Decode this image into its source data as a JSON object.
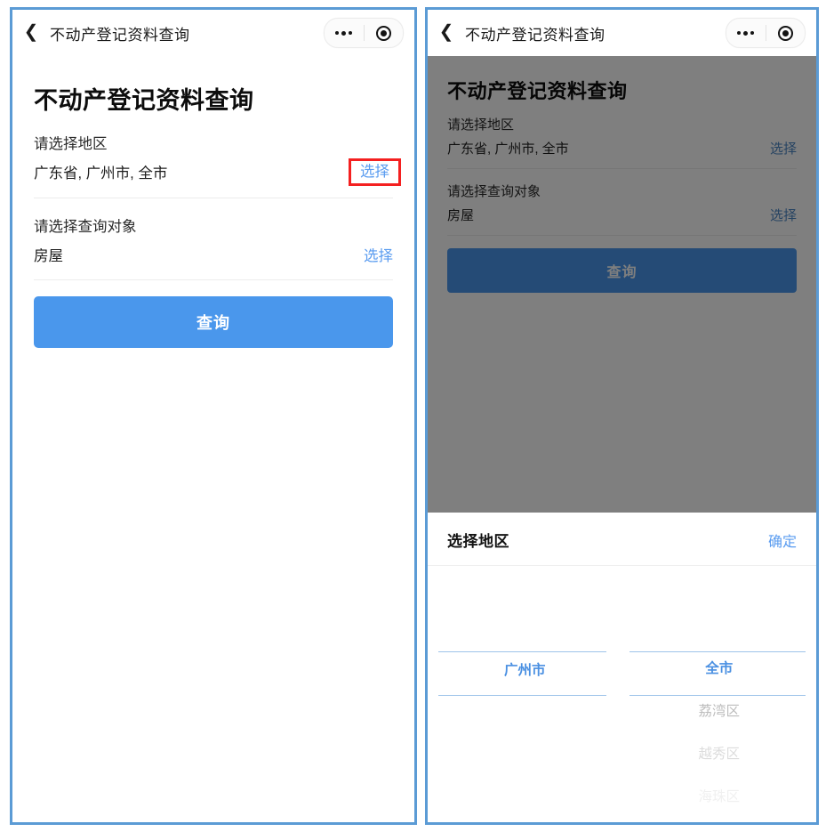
{
  "colors": {
    "accent_blue": "#4a97ec",
    "link_blue": "#5a9cf0",
    "picker_blue": "#4a90e2",
    "highlight_red": "#f42020",
    "frame_blue": "#5b9bd5",
    "overlay_gray": "#808080"
  },
  "navbar": {
    "back_icon": "chevron-left-icon",
    "title": "不动产登记资料查询",
    "more_icon": "more-dots-icon",
    "target_icon": "target-circle-icon"
  },
  "left_panel": {
    "page_title": "不动产登记资料查询",
    "fields": [
      {
        "label": "请选择地区",
        "value": "广东省, 广州市, 全市",
        "action": "选择",
        "highlighted": true
      },
      {
        "label": "请选择查询对象",
        "value": "房屋",
        "action": "选择",
        "highlighted": false
      }
    ],
    "submit_label": "查询"
  },
  "right_panel": {
    "page_title": "不动产登记资料查询",
    "fields": [
      {
        "label": "请选择地区",
        "value": "广东省, 广州市, 全市",
        "action": "选择"
      },
      {
        "label": "请选择查询对象",
        "value": "房屋",
        "action": "选择"
      }
    ],
    "submit_label": "查询",
    "sheet": {
      "title": "选择地区",
      "confirm_label": "确定",
      "columns": [
        {
          "name": "city-column",
          "selected": "广州市",
          "items_below": [
            "",
            "",
            ""
          ]
        },
        {
          "name": "district-column",
          "selected": "全市",
          "items_below": [
            "荔湾区",
            "越秀区",
            "海珠区"
          ]
        }
      ]
    }
  }
}
